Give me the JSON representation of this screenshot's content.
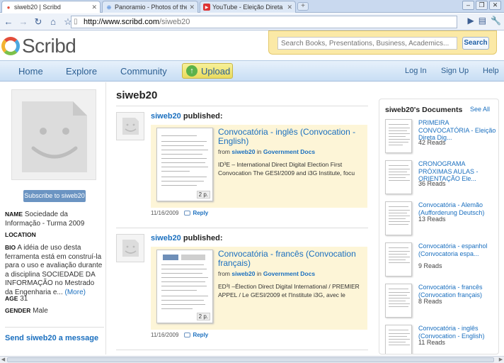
{
  "browser": {
    "tabs": [
      {
        "title": "siweb20 | Scribd",
        "favicon": "scribd-icon"
      },
      {
        "title": "Panoramio - Photos of the ...",
        "favicon": "panoramio-icon"
      },
      {
        "title": "YouTube - Eleição Direta Di...",
        "favicon": "youtube-icon"
      }
    ],
    "url_host": "http://www.scribd.com",
    "url_path": "/siweb20"
  },
  "header": {
    "logo_text": "Scribd",
    "search_placeholder": "Search Books, Presentations, Business, Academics...",
    "search_button": "Search"
  },
  "nav": {
    "home": "Home",
    "explore": "Explore",
    "community": "Community",
    "upload": "Upload",
    "login": "Log In",
    "signup": "Sign Up",
    "help": "Help"
  },
  "profile": {
    "subscribe": "Subscribe to siweb20",
    "name_label": "NAME",
    "name_value": "Sociedade da Informação - Turma 2009",
    "location_label": "LOCATION",
    "bio_label": "BIO",
    "bio_value": "A idéia de uso desta ferramenta está em construí-la para o uso e avaliação durante a disciplina SOCIEDADE DA INFORMAÇÃO no Mestrado da Engenharia e...",
    "bio_more": "(More)",
    "age_label": "AGE",
    "age_value": "31",
    "gender_label": "GENDER",
    "gender_value": "Male",
    "send_message": "Send siweb20 a message"
  },
  "main": {
    "title": "siweb20",
    "feed": [
      {
        "user": "siweb20",
        "action": "published:",
        "doc_title": "Convocatória - inglês (Convocation - English)",
        "from_prefix": "from",
        "from_user": "siweb20",
        "in_word": "in",
        "category": "Government Docs",
        "description": "ID³E – International Direct Digital Election First Convocation The GESI/2009 and i3G Institute, focu",
        "pages": "2 p.",
        "date": "11/16/2009",
        "reply": "Reply"
      },
      {
        "user": "siweb20",
        "action": "published:",
        "doc_title": "Convocatória - francês (Convocation français)",
        "from_prefix": "from",
        "from_user": "siweb20",
        "in_word": "in",
        "category": "Government Docs",
        "description": "ED³I –Élection Direct Digital International / PREMIER APPEL / Le GESI/2009 et l'Institute i3G, avec le",
        "pages": "2 p.",
        "date": "11/16/2009",
        "reply": "Reply"
      }
    ]
  },
  "documents": {
    "title": "siweb20's Documents",
    "see_all": "See All",
    "items": [
      {
        "title": "PRIMEIRA CONVOCATÓRIA - Eleição Direta Dig...",
        "reads": "42 Reads"
      },
      {
        "title": "CRONOGRAMA PRÓXIMAS AULAS - ORIENTAÇÃO Ele...",
        "reads": "36 Reads"
      },
      {
        "title": "Convocatória - Alemão (Aufforderung Deutsch)",
        "reads": "13 Reads"
      },
      {
        "title": "Convocatória - espanhol (Convocatoria espa...",
        "reads": "9 Reads"
      },
      {
        "title": "Convocatória - francês (Convocation français)",
        "reads": "8 Reads"
      },
      {
        "title": "Convocatória - inglês (Convocation - English)",
        "reads": "11 Reads"
      }
    ]
  }
}
